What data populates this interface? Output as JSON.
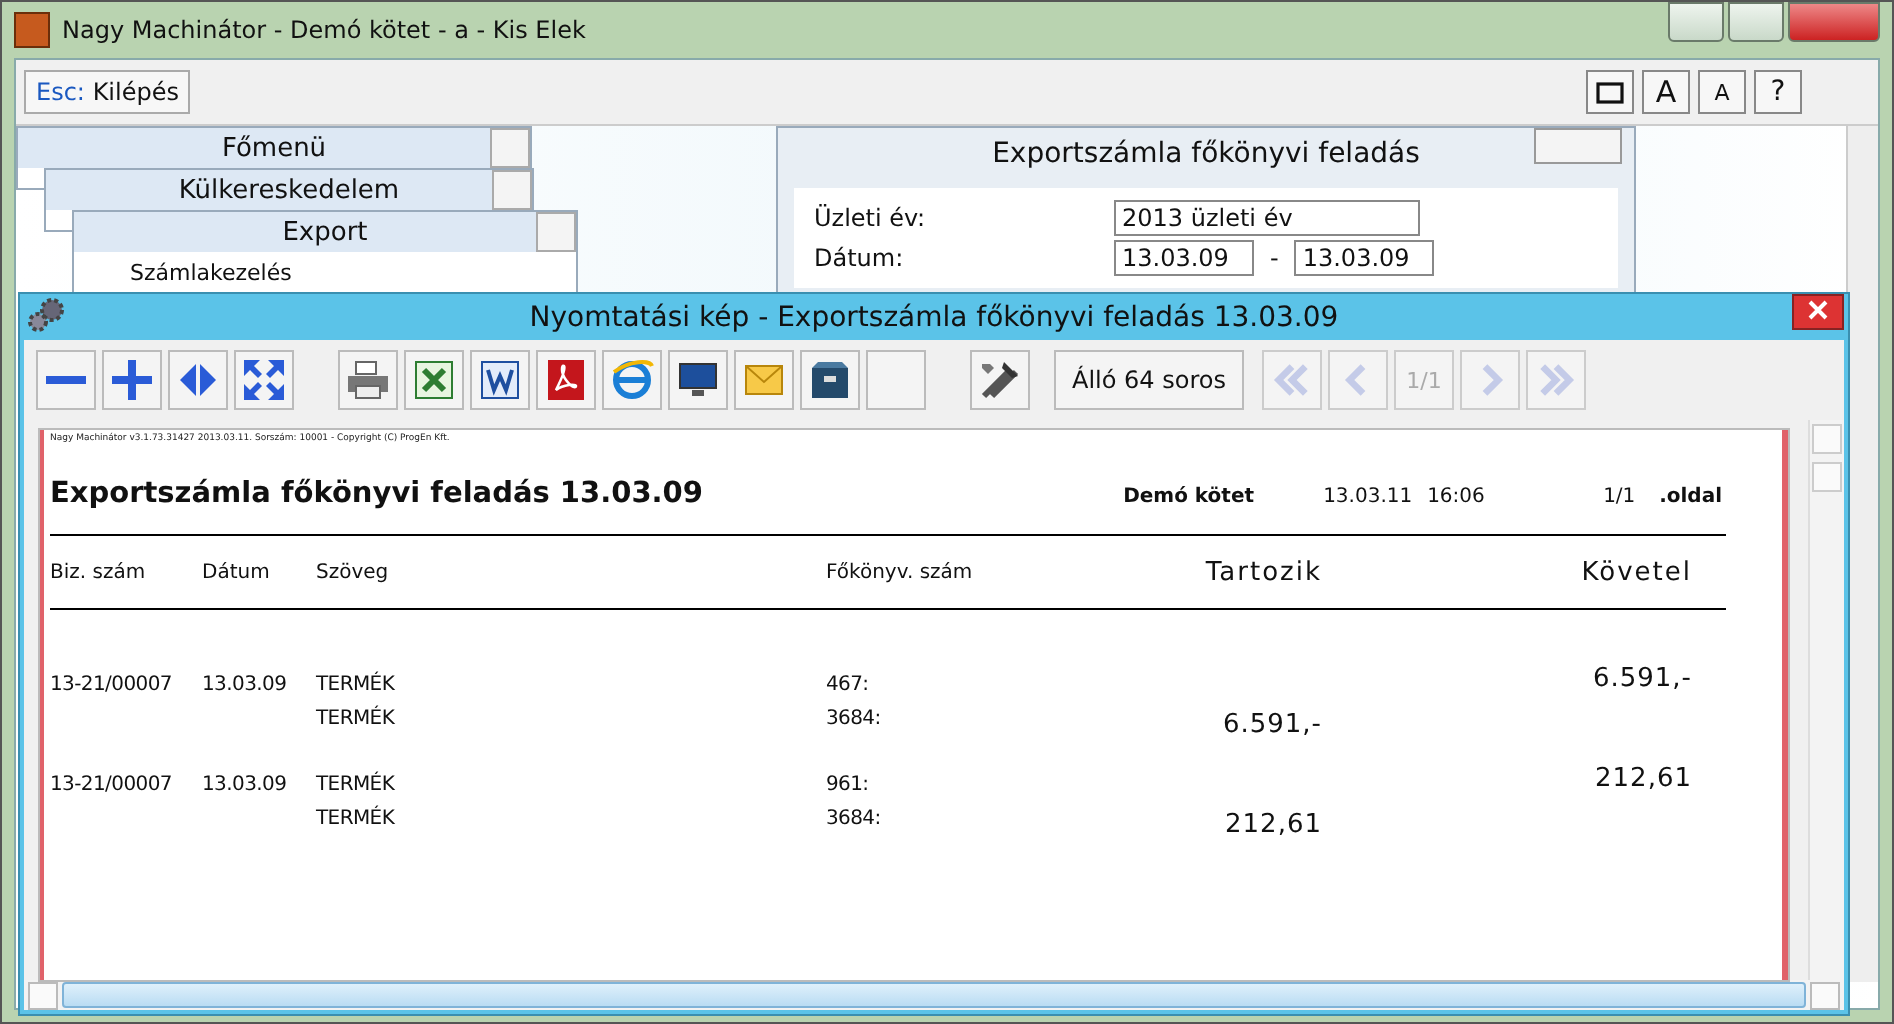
{
  "window": {
    "title": "Nagy Machinátor - Demó kötet - a - Kis Elek"
  },
  "toolbar": {
    "key": "Esc:",
    "label": "Kilépés",
    "font_buttons": [
      "A",
      "A",
      "?"
    ]
  },
  "menus": [
    {
      "title": "Főmenü"
    },
    {
      "title": "Külkereskedelem"
    },
    {
      "title": "Export",
      "items": [
        "Számlakezelés"
      ]
    }
  ],
  "dialog": {
    "title": "Exportszámla főkönyvi feladás",
    "fields": [
      {
        "label": "Üzleti év:",
        "value": "2013 üzleti év"
      },
      {
        "label": "Dátum:",
        "value": "13.03.09",
        "separator": "-",
        "value_to": "13.03.09"
      }
    ]
  },
  "preview": {
    "title": "Nyomtatási kép - Exportszámla főkönyvi feladás 13.03.09",
    "tools": [
      {
        "kind": "zoom-out"
      },
      {
        "kind": "zoom-in"
      },
      {
        "kind": "fit-width"
      },
      {
        "kind": "fit-page"
      },
      {
        "kind": "sep"
      },
      {
        "kind": "printer"
      },
      {
        "kind": "excel"
      },
      {
        "kind": "word"
      },
      {
        "kind": "pdf"
      },
      {
        "kind": "browser"
      },
      {
        "kind": "monitor"
      },
      {
        "kind": "mail"
      },
      {
        "kind": "archive"
      },
      {
        "kind": "blank"
      },
      {
        "kind": "sep"
      },
      {
        "kind": "tools"
      }
    ],
    "orientation_button": "Álló 64 soros",
    "nav": [
      {
        "kind": "first",
        "disabled": true
      },
      {
        "kind": "prev",
        "disabled": true
      },
      {
        "kind": "page",
        "label": "1/1",
        "disabled": true
      },
      {
        "kind": "next",
        "disabled": true
      },
      {
        "kind": "last",
        "disabled": true
      }
    ]
  },
  "document": {
    "note": "Nagy Machinátor v3.1.73.31427 2013.03.11. Sorszám: 10001 - Copyright (C) ProgEn Kft.",
    "title": "Exportszámla főkönyvi feladás 13.03.09",
    "volume": "Demó kötet",
    "date": "13.03.11",
    "time": "16:06",
    "page": "1/1",
    "page_label": ".oldal",
    "columns": [
      "Biz. szám",
      "Dátum",
      "Szöveg",
      "Főkönyv. szám",
      "Tartozik",
      "Követel"
    ],
    "rows": [
      {
        "number": "13-21/00007",
        "date": "13.03.09",
        "lines": [
          {
            "text": "TERMÉK",
            "account": "467:",
            "credit": "6.591,-"
          },
          {
            "text": "TERMÉK",
            "account": "3684:",
            "debit": "6.591,-"
          }
        ]
      },
      {
        "number": "13-21/00007",
        "date": "13.03.09",
        "lines": [
          {
            "text": "TERMÉK",
            "account": "961:",
            "credit": "212,61"
          },
          {
            "text": "TERMÉK",
            "account": "3684:",
            "debit": "212,61"
          }
        ]
      }
    ]
  }
}
